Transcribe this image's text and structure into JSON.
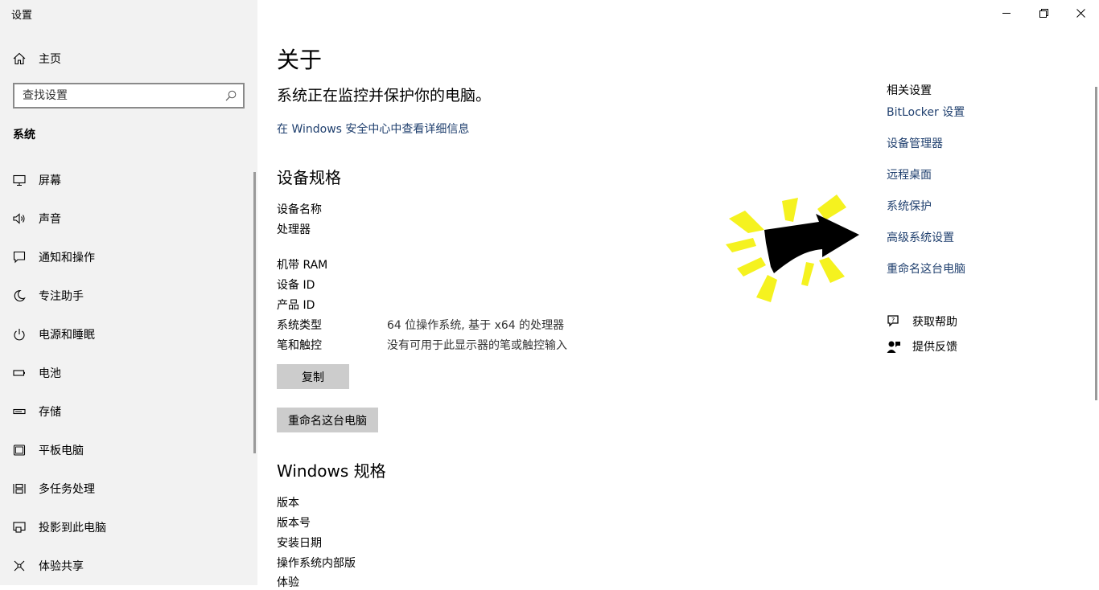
{
  "window": {
    "title": "设置"
  },
  "sidebar": {
    "home_label": "主页",
    "search_placeholder": "查找设置",
    "section_label": "系统",
    "items": [
      {
        "label": "屏幕",
        "icon": "monitor-icon"
      },
      {
        "label": "声音",
        "icon": "speaker-icon"
      },
      {
        "label": "通知和操作",
        "icon": "notification-icon"
      },
      {
        "label": "专注助手",
        "icon": "moon-icon"
      },
      {
        "label": "电源和睡眠",
        "icon": "power-icon"
      },
      {
        "label": "电池",
        "icon": "battery-icon"
      },
      {
        "label": "存储",
        "icon": "storage-icon"
      },
      {
        "label": "平板电脑",
        "icon": "tablet-icon"
      },
      {
        "label": "多任务处理",
        "icon": "multitask-icon"
      },
      {
        "label": "投影到此电脑",
        "icon": "project-icon"
      },
      {
        "label": "体验共享",
        "icon": "share-icon"
      }
    ]
  },
  "main": {
    "title": "关于",
    "status": "系统正在监控并保护你的电脑。",
    "security_link": "在 Windows 安全中心中查看详细信息",
    "device_spec": {
      "heading": "设备规格",
      "rows": [
        {
          "label": "设备名称",
          "value": ""
        },
        {
          "label": "处理器",
          "value": ""
        },
        {
          "label": "机带 RAM",
          "value": ""
        },
        {
          "label": "设备 ID",
          "value": ""
        },
        {
          "label": "产品 ID",
          "value": ""
        },
        {
          "label": "系统类型",
          "value": "64 位操作系统, 基于 x64 的处理器"
        },
        {
          "label": "笔和触控",
          "value": "没有可用于此显示器的笔或触控输入"
        }
      ],
      "copy_button": "复制",
      "rename_button": "重命名这台电脑"
    },
    "windows_spec": {
      "heading": "Windows 规格",
      "rows": [
        {
          "label": "版本"
        },
        {
          "label": "版本号"
        },
        {
          "label": "安装日期"
        },
        {
          "label": "操作系统内部版"
        },
        {
          "label": "体验"
        }
      ]
    }
  },
  "related": {
    "heading": "相关设置",
    "links": [
      "BitLocker 设置",
      "设备管理器",
      "远程桌面",
      "系统保护",
      "高级系统设置",
      "重命名这台电脑"
    ],
    "help": [
      {
        "label": "获取帮助",
        "icon": "help-chat-icon"
      },
      {
        "label": "提供反馈",
        "icon": "feedback-icon"
      }
    ]
  },
  "colors": {
    "sidebar_bg": "#f2f2f2",
    "button_bg": "#cccccc",
    "link": "#1f3f6e",
    "arrow": "#000000",
    "glow": "#f5f21f"
  }
}
